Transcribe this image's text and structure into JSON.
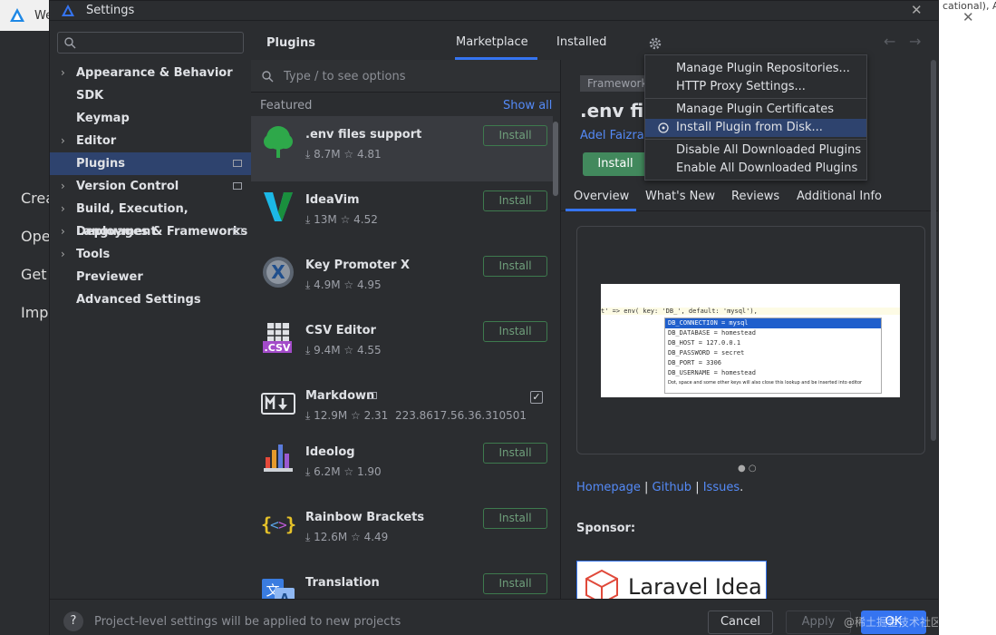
{
  "background": {
    "window_title": "We",
    "left_items": [
      "Crea",
      "Ope",
      "Get",
      "Impo"
    ],
    "right_snippet": "cational), A"
  },
  "dialog": {
    "title": "Settings"
  },
  "tree": {
    "items": [
      {
        "label": "Appearance & Behavior",
        "arrow": "›"
      },
      {
        "label": "SDK",
        "arrow": ""
      },
      {
        "label": "Keymap",
        "arrow": ""
      },
      {
        "label": "Editor",
        "arrow": "›"
      },
      {
        "label": "Plugins",
        "arrow": ""
      },
      {
        "label": "Version Control",
        "arrow": "›"
      },
      {
        "label": "Build, Execution, Deployment",
        "arrow": "›"
      },
      {
        "label": "Languages & Frameworks",
        "arrow": "›"
      },
      {
        "label": "Tools",
        "arrow": "›"
      },
      {
        "label": "Previewer",
        "arrow": ""
      },
      {
        "label": "Advanced Settings",
        "arrow": ""
      }
    ]
  },
  "plugins_header": {
    "title": "Plugins",
    "tab_marketplace": "Marketplace",
    "tab_installed": "Installed"
  },
  "marketplace": {
    "search_placeholder": "Type / to see options",
    "featured_label": "Featured",
    "show_all": "Show all",
    "plugins": [
      {
        "name": ".env files support",
        "downloads": "8.7M",
        "rating": "4.81",
        "button": "Install"
      },
      {
        "name": "IdeaVim",
        "downloads": "13M",
        "rating": "4.52",
        "button": "Install"
      },
      {
        "name": "Key Promoter X",
        "downloads": "4.9M",
        "rating": "4.95",
        "button": "Install"
      },
      {
        "name": "CSV Editor",
        "downloads": "9.4M",
        "rating": "4.55",
        "button": "Install"
      },
      {
        "name": "Markdown",
        "downloads": "12.9M",
        "rating": "2.31",
        "version": "223.8617.56.36.310501",
        "button": ""
      },
      {
        "name": "Ideolog",
        "downloads": "6.2M",
        "rating": "1.90",
        "button": "Install"
      },
      {
        "name": "Rainbow Brackets",
        "downloads": "12.6M",
        "rating": "4.49",
        "button": "Install"
      },
      {
        "name": "Translation",
        "downloads": "",
        "rating": "",
        "button": "Install"
      }
    ]
  },
  "detail": {
    "badge": "Framework",
    "name": ".env files",
    "author": "Adel Faizrak",
    "install_label": "Install",
    "tabs": [
      "Overview",
      "What's New",
      "Reviews",
      "Additional Info"
    ],
    "screenshot_lines": [
      "t' => env( key: 'DB_', default: 'mysql'),",
      "DB_CONNECTION = mysql",
      "DB_DATABASE = homestead",
      "DB_HOST = 127.0.0.1",
      "DB_PASSWORD = secret",
      "DB_PORT = 3306",
      "DB_USERNAME = homestead",
      "Dot, space and some other keys will also close this lookup and be inserted into editor"
    ],
    "links": {
      "homepage": "Homepage",
      "github": "Github",
      "issues": "Issues",
      "sep": "|",
      "end": "."
    },
    "sponsor_label": "Sponsor:",
    "sponsor_name": "Laravel Idea"
  },
  "menu": {
    "items": [
      "Manage Plugin Repositories...",
      "HTTP Proxy Settings...",
      "Manage Plugin Certificates",
      "Install Plugin from Disk...",
      "Disable All Downloaded Plugins",
      "Enable All Downloaded Plugins"
    ]
  },
  "footer": {
    "help": "?",
    "note": "Project-level settings will be applied to new projects",
    "cancel": "Cancel",
    "apply": "Apply",
    "ok": "OK",
    "watermark": "@稀土掘金技术社区 CSDN @wshaper"
  },
  "colors": {
    "accent": "#3574f0",
    "selection": "#2e436e",
    "install_green": "#42895d",
    "link": "#548af7"
  }
}
